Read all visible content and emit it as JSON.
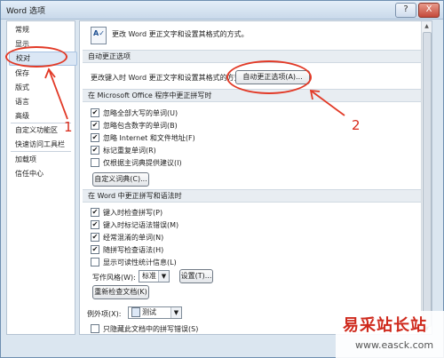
{
  "window": {
    "title": "Word 选项",
    "help": "?",
    "close": "X"
  },
  "sidebar": {
    "items": [
      "常规",
      "显示",
      "校对",
      "保存",
      "版式",
      "语言",
      "高级",
      "自定义功能区",
      "快速访问工具栏",
      "加载项",
      "信任中心"
    ],
    "selected": "校对"
  },
  "main": {
    "header": "更改 Word 更正文字和设置其格式的方式。",
    "autocorrect": {
      "section": "自动更正选项",
      "desc": "更改键入时 Word 更正文字和设置其格式的方式：",
      "button": "自动更正选项(A)..."
    },
    "office": {
      "section": "在 Microsoft Office 程序中更正拼写时",
      "options": [
        {
          "label": "忽略全部大写的单词(U)",
          "checked": true
        },
        {
          "label": "忽略包含数字的单词(B)",
          "checked": true
        },
        {
          "label": "忽略 Internet 和文件地址(F)",
          "checked": true
        },
        {
          "label": "标记重复单词(R)",
          "checked": true
        },
        {
          "label": "仅根据主词典提供建议(I)",
          "checked": false
        }
      ],
      "dict_button": "自定义词典(C)..."
    },
    "word": {
      "section": "在 Word 中更正拼写和语法时",
      "options": [
        {
          "label": "键入时检查拼写(P)",
          "checked": true
        },
        {
          "label": "键入时标记语法错误(M)",
          "checked": true
        },
        {
          "label": "经常混淆的单词(N)",
          "checked": true
        },
        {
          "label": "随拼写检查语法(H)",
          "checked": true
        },
        {
          "label": "显示可读性统计信息(L)",
          "checked": false
        }
      ],
      "style_label": "写作风格(W):",
      "style_value": "标准",
      "settings_button": "设置(T)...",
      "recheck_button": "重新检查文档(K)"
    },
    "exceptions": {
      "label": "例外项(X):",
      "doc": "测试",
      "options": [
        {
          "label": "只隐藏此文档中的拼写错误(S)",
          "checked": false
        }
      ]
    }
  },
  "annotations": {
    "num1": "1",
    "num2": "2",
    "color": "#e23a27"
  },
  "watermark": {
    "title": "易采站长站",
    "url": "www.easck.com"
  },
  "check_glyph": "✔",
  "arrow_glyph": "▼"
}
